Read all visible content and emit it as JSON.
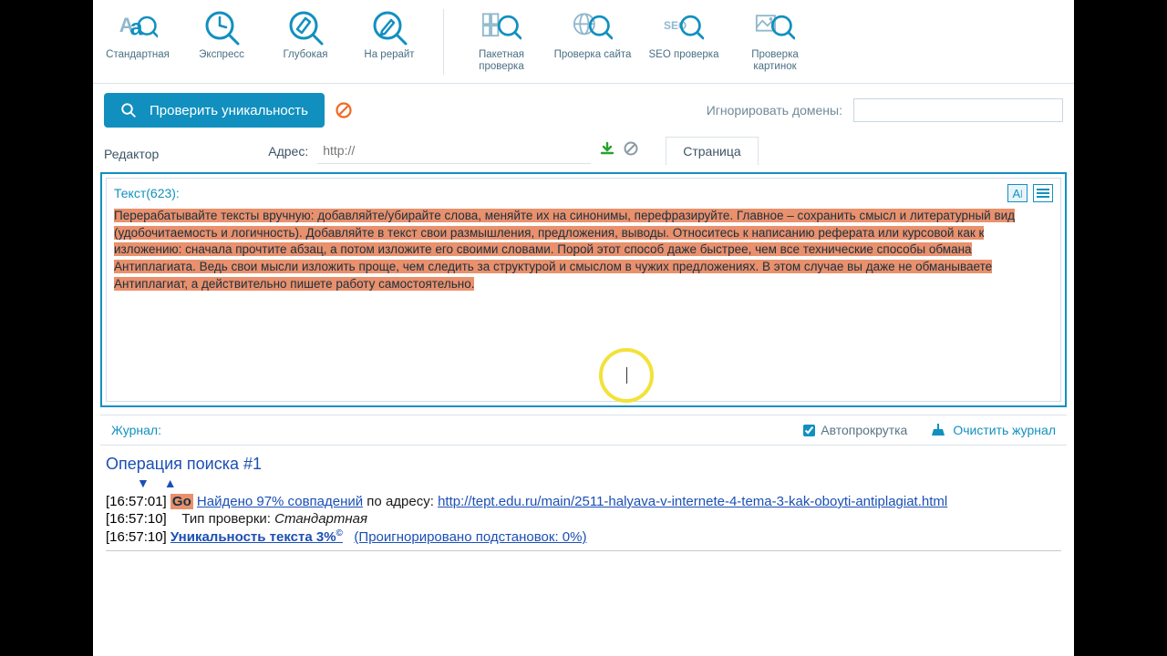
{
  "colors": {
    "accent": "#1190bf",
    "highlight": "#e9906c"
  },
  "toolbar": {
    "items1": [
      {
        "id": "standard",
        "label": "Стандартная",
        "icon": "Aa-magnifier"
      },
      {
        "id": "express",
        "label": "Экспресс",
        "icon": "clock-magnifier"
      },
      {
        "id": "deep",
        "label": "Глубокая",
        "icon": "wrench-magnifier"
      },
      {
        "id": "rewrite",
        "label": "На рерайт",
        "icon": "pencil-magnifier"
      }
    ],
    "items2": [
      {
        "id": "batch",
        "label": "Пакетная проверка",
        "icon": "grid-magnifier"
      },
      {
        "id": "site",
        "label": "Проверка сайта",
        "icon": "globe-magnifier"
      },
      {
        "id": "seo",
        "label": "SEO проверка",
        "icon": "seo-magnifier"
      },
      {
        "id": "images",
        "label": "Проверка картинок",
        "icon": "image-magnifier"
      }
    ]
  },
  "actions": {
    "check": "Проверить уникальность",
    "ignore_label": "Игнорировать домены:",
    "ignore_value": ""
  },
  "editor": {
    "tab_editor": "Редактор",
    "addr_label": "Адрес:",
    "addr_placeholder": "http://",
    "page_tab": "Страница",
    "count_label": "Текст(623):",
    "text": "Перерабатывайте тексты вручную: добавляйте/убирайте слова, меняйте их на синонимы, перефразируйте. Главное – сохранить смысл и литературный вид (удобочитаемость и логичность).\nДобавляйте в текст свои размышления, предложения, выводы. Относитесь к написанию реферата или курсовой как к изложению: сначала прочтите абзац, а потом изложите его своими словами. Порой этот способ даже быстрее, чем все технические способы обмана Антиплагиата. Ведь свои мысли изложить проще, чем следить за структурой и смыслом в чужих предложениях. В этом случае вы даже не обманываете Антиплагиат, а действительно пишете работу самостоятельно."
  },
  "log": {
    "title": "Журнал:",
    "auto": "Автопрокрутка",
    "auto_checked": true,
    "clear": "Очистить журнал",
    "operation_title": "Операция поиска #1",
    "lines": [
      {
        "ts": "[16:57:01]",
        "go": "Go",
        "text": "Найдено 97% совпадений",
        "mid": " по адресу: ",
        "url": "http://tept.edu.ru/main/2511-halyava-v-internete-4-tema-3-kak-oboyti-antiplagiat.html"
      },
      {
        "ts": "[16:57:10]",
        "plain_label": "Тип проверки: ",
        "plain_value": "Стандартная"
      },
      {
        "ts": "[16:57:10]",
        "uniq": "Уникальность текста 3%",
        "ign": "(Проигнорировано подстановок: 0%)"
      }
    ]
  }
}
